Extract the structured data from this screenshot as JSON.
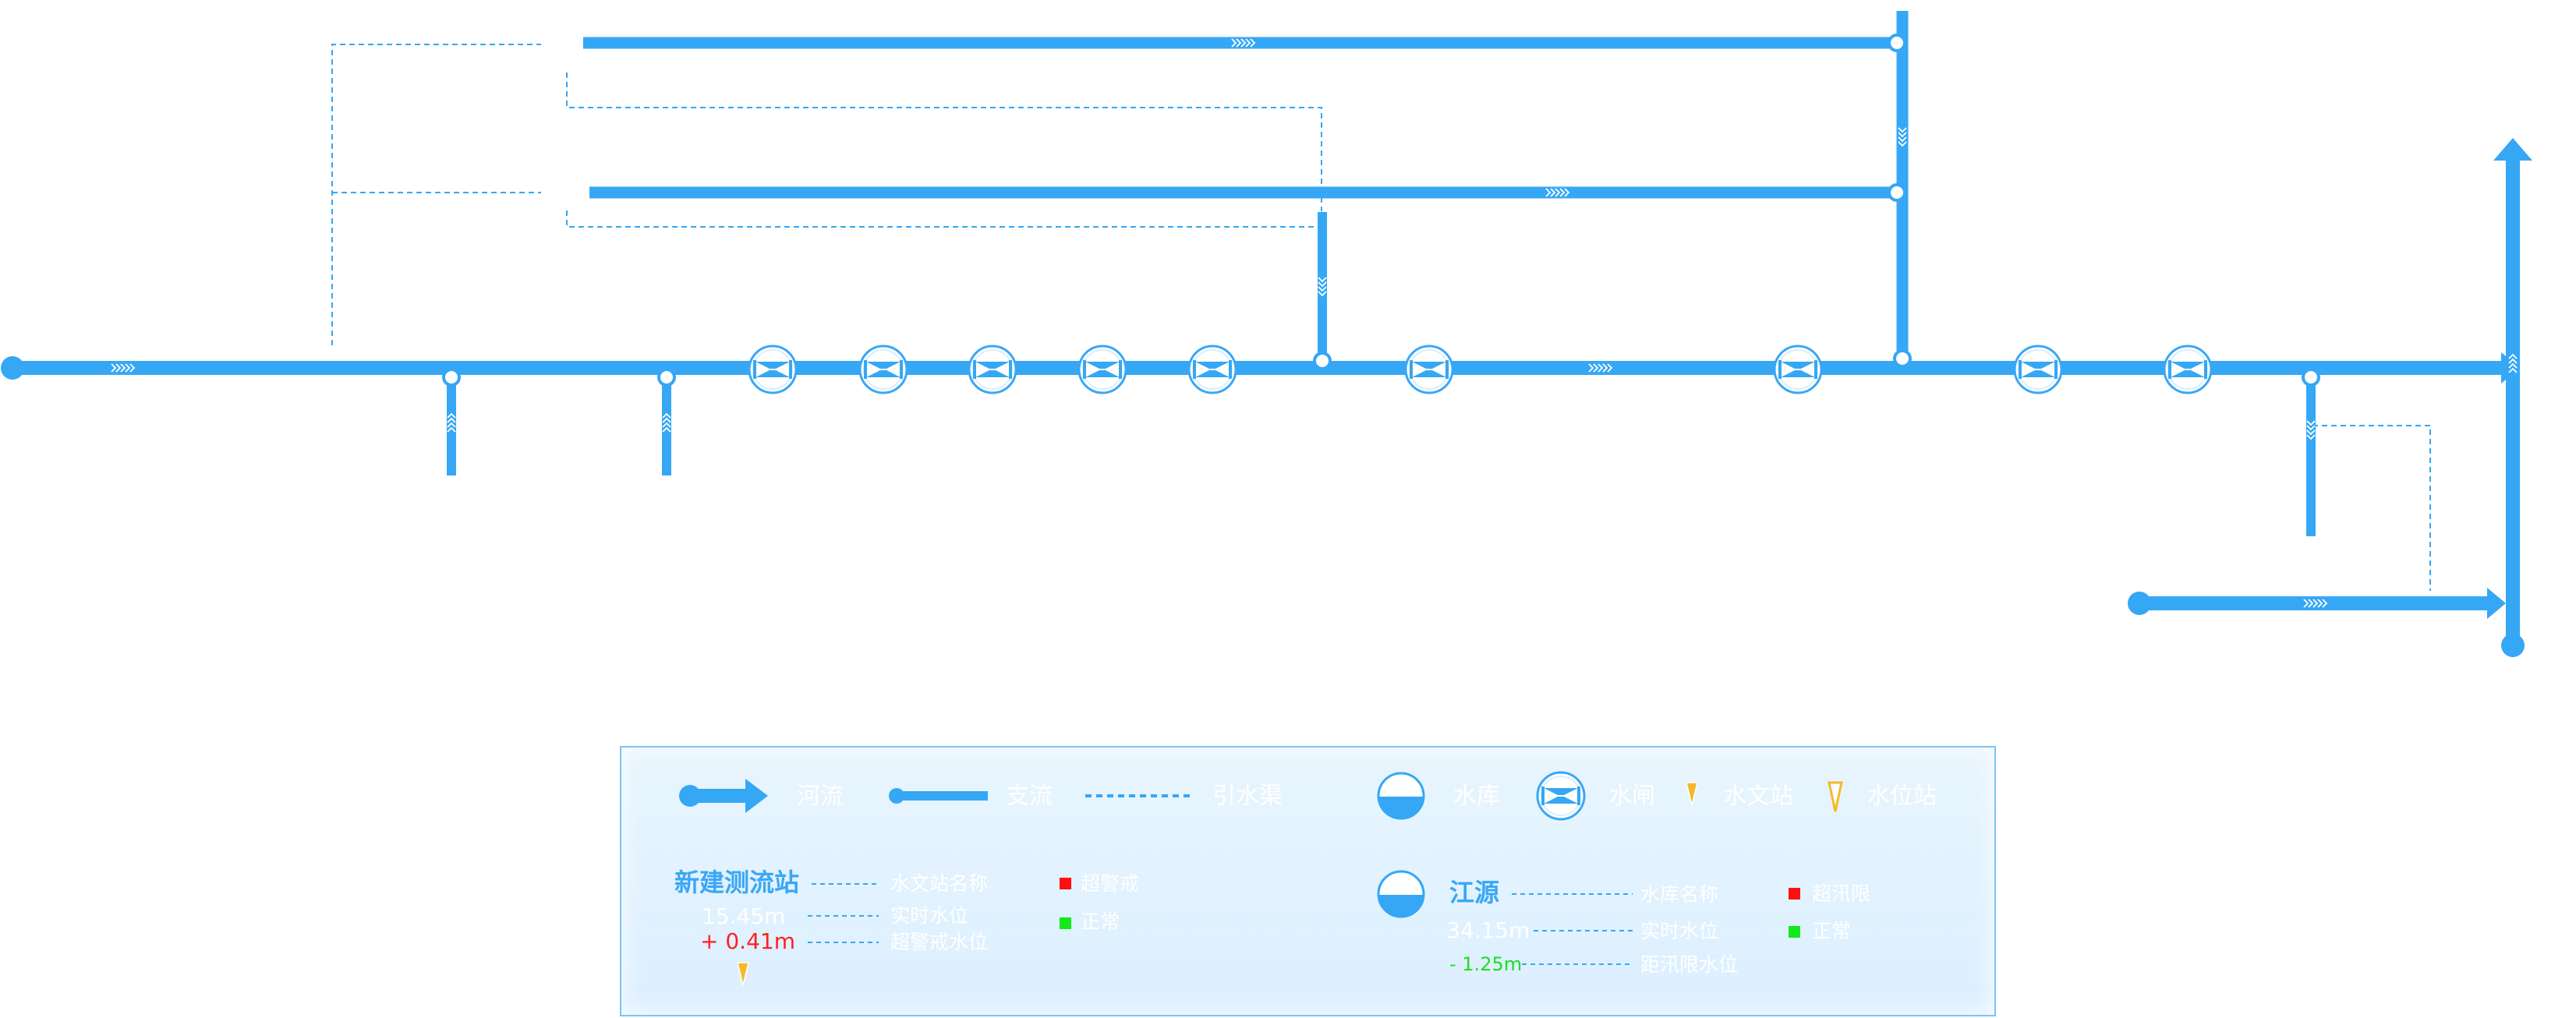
{
  "colors": {
    "river": "#35a7f5",
    "canal": "#35a7f5",
    "alarm": "#ff1010",
    "normal": "#14e81a",
    "station": "#f5b92a"
  },
  "legend": {
    "items": {
      "river": "河流",
      "tributary": "支流",
      "canal": "引水渠",
      "reservoir": "水库",
      "sluice": "水闸",
      "hydro_station": "水文站",
      "level_station": "水位站"
    },
    "hydro_example": {
      "name": "新建测流站",
      "level": "15.45m",
      "delta": "+ 0.41m",
      "name_caption": "水文站名称",
      "level_caption": "实时水位",
      "delta_caption": "超警戒水位",
      "status_alarm": "超警戒",
      "status_normal": "正常"
    },
    "reservoir_example": {
      "name": "江源",
      "level": "34.15m",
      "delta": "- 1.25m",
      "name_caption": "水库名称",
      "level_caption": "实时水位",
      "delta_caption": "距汛限水位",
      "status_alarm": "超汛限",
      "status_normal": "正常"
    }
  }
}
